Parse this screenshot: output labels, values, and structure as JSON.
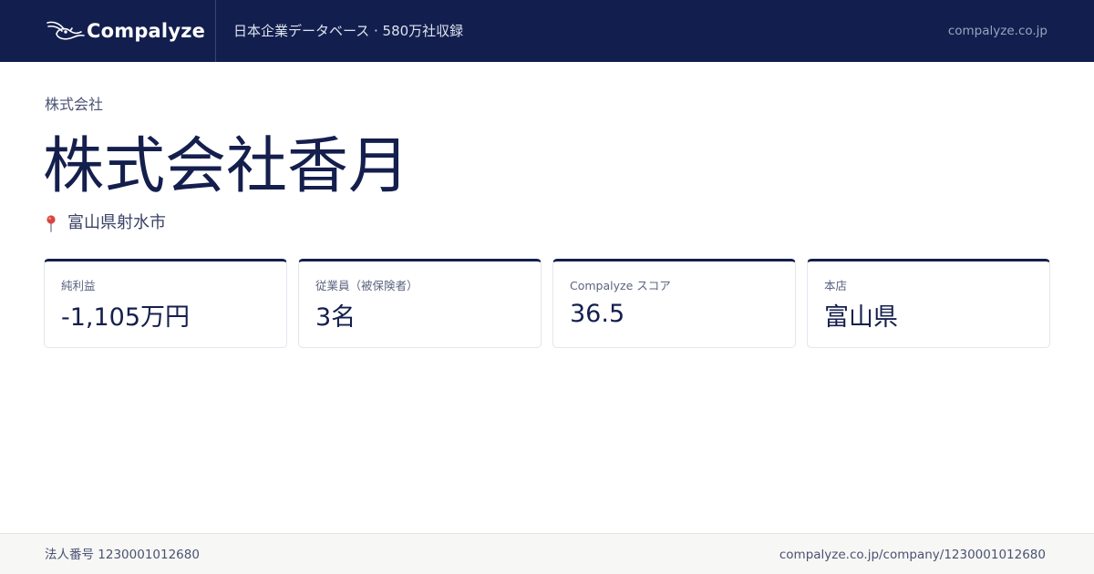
{
  "header": {
    "brand": "Compalyze",
    "tagline": "日本企業データベース · 580万社収録",
    "domain": "compalyze.co.jp",
    "logo_icon": "bird-icon"
  },
  "company": {
    "type_label": "株式会社",
    "name": "株式会社香月",
    "location": "富山県射水市",
    "location_icon": "map-pin-icon"
  },
  "metrics": [
    {
      "label": "純利益",
      "value": "-1,105万円"
    },
    {
      "label": "従業員（被保険者）",
      "value": "3名"
    },
    {
      "label": "Compalyze スコア",
      "value": "36.5"
    },
    {
      "label": "本店",
      "value": "富山県"
    }
  ],
  "footer": {
    "corporate_number": "法人番号 1230001012680",
    "url": "compalyze.co.jp/company/1230001012680"
  },
  "colors": {
    "header_bg": "#121f4e",
    "text_primary": "#141f4d",
    "card_accent": "#141f4d",
    "pin": "#d9453f",
    "footer_bg": "#f7f7f5"
  }
}
